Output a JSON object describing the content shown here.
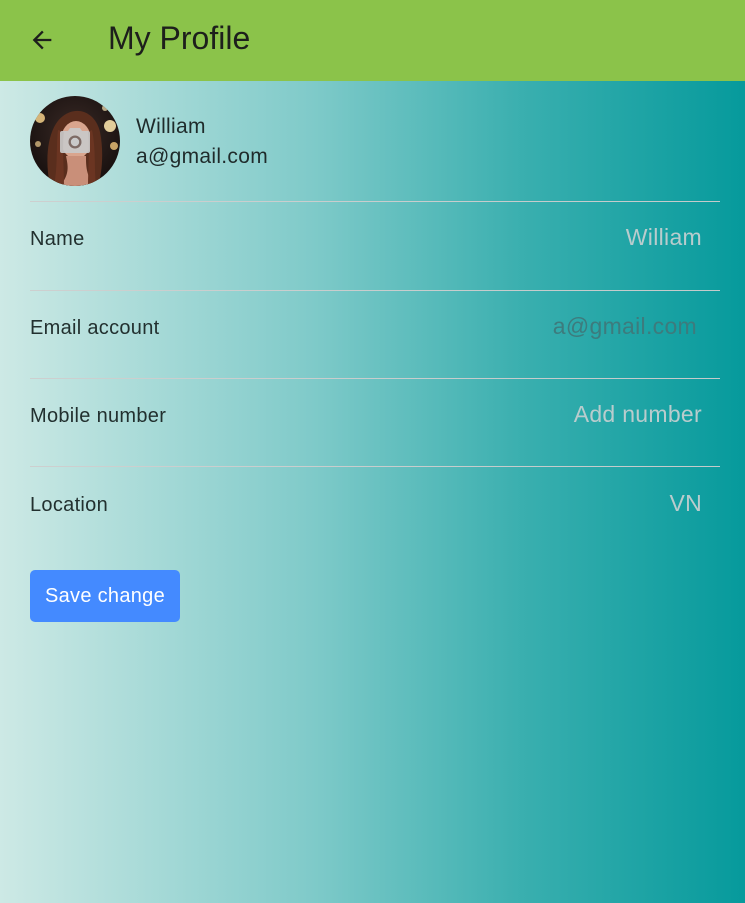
{
  "appbar": {
    "title": "My Profile",
    "back_icon": "arrow-left-icon",
    "color": "#8bc34a"
  },
  "profile": {
    "name": "William",
    "email": "a@gmail.com",
    "avatar_overlay_icon": "camera-icon"
  },
  "fields": [
    {
      "label": "Name",
      "value": "William"
    },
    {
      "label": "Email account",
      "value": "a@gmail.com"
    },
    {
      "label": "Mobile number",
      "placeholder": "Add number"
    },
    {
      "label": "Location",
      "value": "VN"
    }
  ],
  "actions": {
    "save_label": "Save change",
    "save_color": "#448aff"
  },
  "background": {
    "gradient_start": "#cde9e5",
    "gradient_end": "#069a9c"
  }
}
